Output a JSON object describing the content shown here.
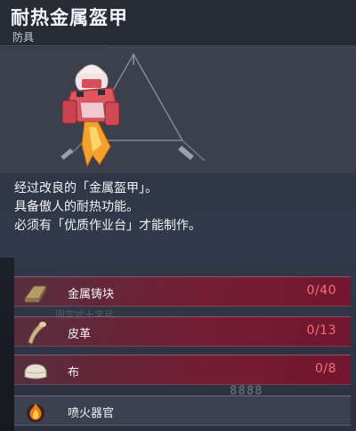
{
  "item": {
    "title": "耐热金属盔甲",
    "category": "防具",
    "description": [
      "经过改良的「金属盔甲」。",
      "具备傲人的耐热功能。",
      "必须有「优质作业台」才能制作。"
    ]
  },
  "materials": [
    {
      "name": "金属铸块",
      "count": "0/40",
      "icon": "metal-ingot-icon",
      "status": "missing"
    },
    {
      "name": "皮革",
      "count": "0/13",
      "icon": "leather-icon",
      "status": "missing"
    },
    {
      "name": "布",
      "count": "0/8",
      "icon": "cloth-icon",
      "status": "missing"
    },
    {
      "name": "喷火器官",
      "count": "",
      "icon": "flame-organ-icon",
      "status": "ok"
    }
  ],
  "background": {
    "ghost_label_1": "固定式十字弓",
    "digits": "8888"
  },
  "colors": {
    "missing_count": "#ff6a7a",
    "missing_row": "#8c142d",
    "armor_red": "#e0565f"
  }
}
